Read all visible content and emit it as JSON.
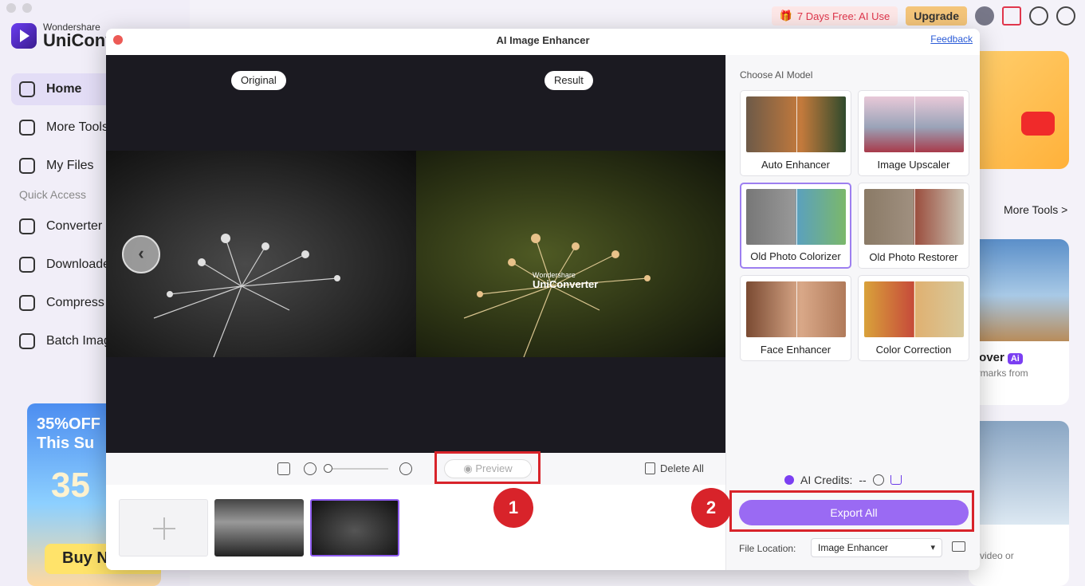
{
  "app": {
    "brand_small": "Wondershare",
    "brand_big": "UniConver",
    "nav": [
      {
        "label": "Home",
        "icon": "home-icon"
      },
      {
        "label": "More Tools",
        "icon": "toolbox-icon"
      },
      {
        "label": "My Files",
        "icon": "file-icon"
      }
    ],
    "quick_access_label": "Quick Access",
    "quick": [
      {
        "label": "Converter",
        "icon": "converter-icon"
      },
      {
        "label": "Downloade",
        "icon": "download-icon"
      },
      {
        "label": "Compress",
        "icon": "compress-icon"
      },
      {
        "label": "Batch Imag",
        "icon": "image-icon"
      }
    ],
    "promo": {
      "line1": "35%OFF",
      "line2": "This Su",
      "big": "35",
      "button": "Buy N"
    },
    "topbar": {
      "free_label": "7 Days Free: AI Use",
      "upgrade": "Upgrade"
    },
    "more_tools_link": "More Tools >",
    "card2": {
      "title": "nover",
      "ai_badge": "Ai",
      "sub": "ermarks from"
    },
    "card3": {
      "sub": "a video or"
    }
  },
  "dialog": {
    "title": "AI Image Enhancer",
    "feedback": "Feedback",
    "original_label": "Original",
    "result_label": "Result",
    "watermark_small": "Wondershare",
    "watermark_big": "UniConverter",
    "preview_button": "Preview",
    "delete_all": "Delete All",
    "choose_model_label": "Choose AI Model",
    "models": [
      {
        "label": "Auto Enhancer"
      },
      {
        "label": "Image Upscaler"
      },
      {
        "label": "Old Photo Colorizer",
        "selected": true
      },
      {
        "label": "Old Photo Restorer"
      },
      {
        "label": "Face Enhancer"
      },
      {
        "label": "Color Correction"
      }
    ],
    "credits_label": "AI Credits:",
    "credits_value": "--",
    "export_button": "Export All",
    "file_location_label": "File Location:",
    "file_location_value": "Image Enhancer"
  },
  "annotations": {
    "step1": "1",
    "step2": "2"
  },
  "colors": {
    "accent": "#9a6af3",
    "highlight": "#d8232a"
  }
}
